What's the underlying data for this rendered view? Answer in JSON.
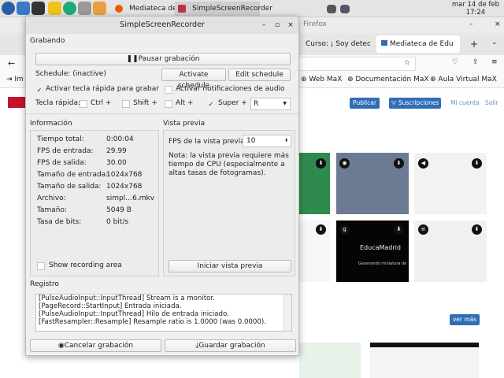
{
  "taskbar": {
    "tasks": [
      {
        "label": "Mediateca de Educa..."
      },
      {
        "label": "SimpleScreenRecorder"
      }
    ],
    "clock": {
      "date": "mar 14 de feb",
      "time": "17:24"
    }
  },
  "firefox": {
    "title": "Firefox",
    "tabs": [
      {
        "label": "Curso: ¡ Soy detec"
      },
      {
        "label": "Mediateca de Edu"
      }
    ],
    "bookmarks": [
      {
        "label": "Im"
      },
      {
        "label": "Web MaX"
      },
      {
        "label": "Documentación MaX"
      },
      {
        "label": "Aula Virtual MaX"
      }
    ],
    "page": {
      "publish": "Publicar",
      "subscriptions": "Suscripciones",
      "account": "Mi cuenta",
      "logout": "Salir",
      "see_more": "ver más",
      "brand": "EducaMadrid",
      "thumb_caption": "Generando miniatura de"
    }
  },
  "dialog": {
    "title": "SimpleScreenRecorder",
    "section_recording": "Grabando",
    "pause": "Pausar grabación",
    "schedule_status": "Schedule: (inactive)",
    "activate_schedule": "Activate schedule",
    "edit_schedule": "Edit schedule",
    "hotkey_enable": {
      "label": "Activar tecla rápida para grabar",
      "checked": true
    },
    "audio_notif": {
      "label": "Activar notificaciones de audio",
      "checked": false
    },
    "hotkey_label": "Tecla rápida:",
    "modifiers": [
      {
        "label": "Ctrl +",
        "checked": false
      },
      {
        "label": "Shift +",
        "checked": false
      },
      {
        "label": "Alt +",
        "checked": false
      },
      {
        "label": "Super +",
        "checked": true
      }
    ],
    "key": "R",
    "info_title": "Información",
    "info": [
      {
        "k": "Tiempo total:",
        "v": "0:00:04"
      },
      {
        "k": "FPS de entrada:",
        "v": "29.99"
      },
      {
        "k": "FPS de salida:",
        "v": "30.00"
      },
      {
        "k": "Tamaño de entrada:",
        "v": "1024x768"
      },
      {
        "k": "Tamaño de salida:",
        "v": "1024x768"
      },
      {
        "k": "Archivo:",
        "v": "simpl…6.mkv"
      },
      {
        "k": "Tamaño:",
        "v": "5049 B"
      },
      {
        "k": "Tasa de bits:",
        "v": "0 bit/s"
      }
    ],
    "show_area": {
      "label": "Show recording area",
      "checked": false
    },
    "preview_title": "Vista previa",
    "preview_fps_label": "FPS de la vista previa:",
    "preview_fps": "10",
    "preview_note": "Nota: la vista previa requiere más tiempo de CPU (especialmente a altas tasas de fotogramas).",
    "start_preview": "Iniciar vista previa",
    "log_title": "Registro",
    "log": [
      "[PulseAudioInput::InputThread] Stream is a monitor.",
      "[PageRecord::StartInput] Entrada iniciada.",
      "[PulseAudioInput::InputThread] Hilo de entrada iniciado.",
      "[FastResampler::Resample] Resample ratio is 1.0000 (was 0.0000)."
    ],
    "cancel": "Cancelar grabación",
    "save": "Guardar grabación"
  }
}
